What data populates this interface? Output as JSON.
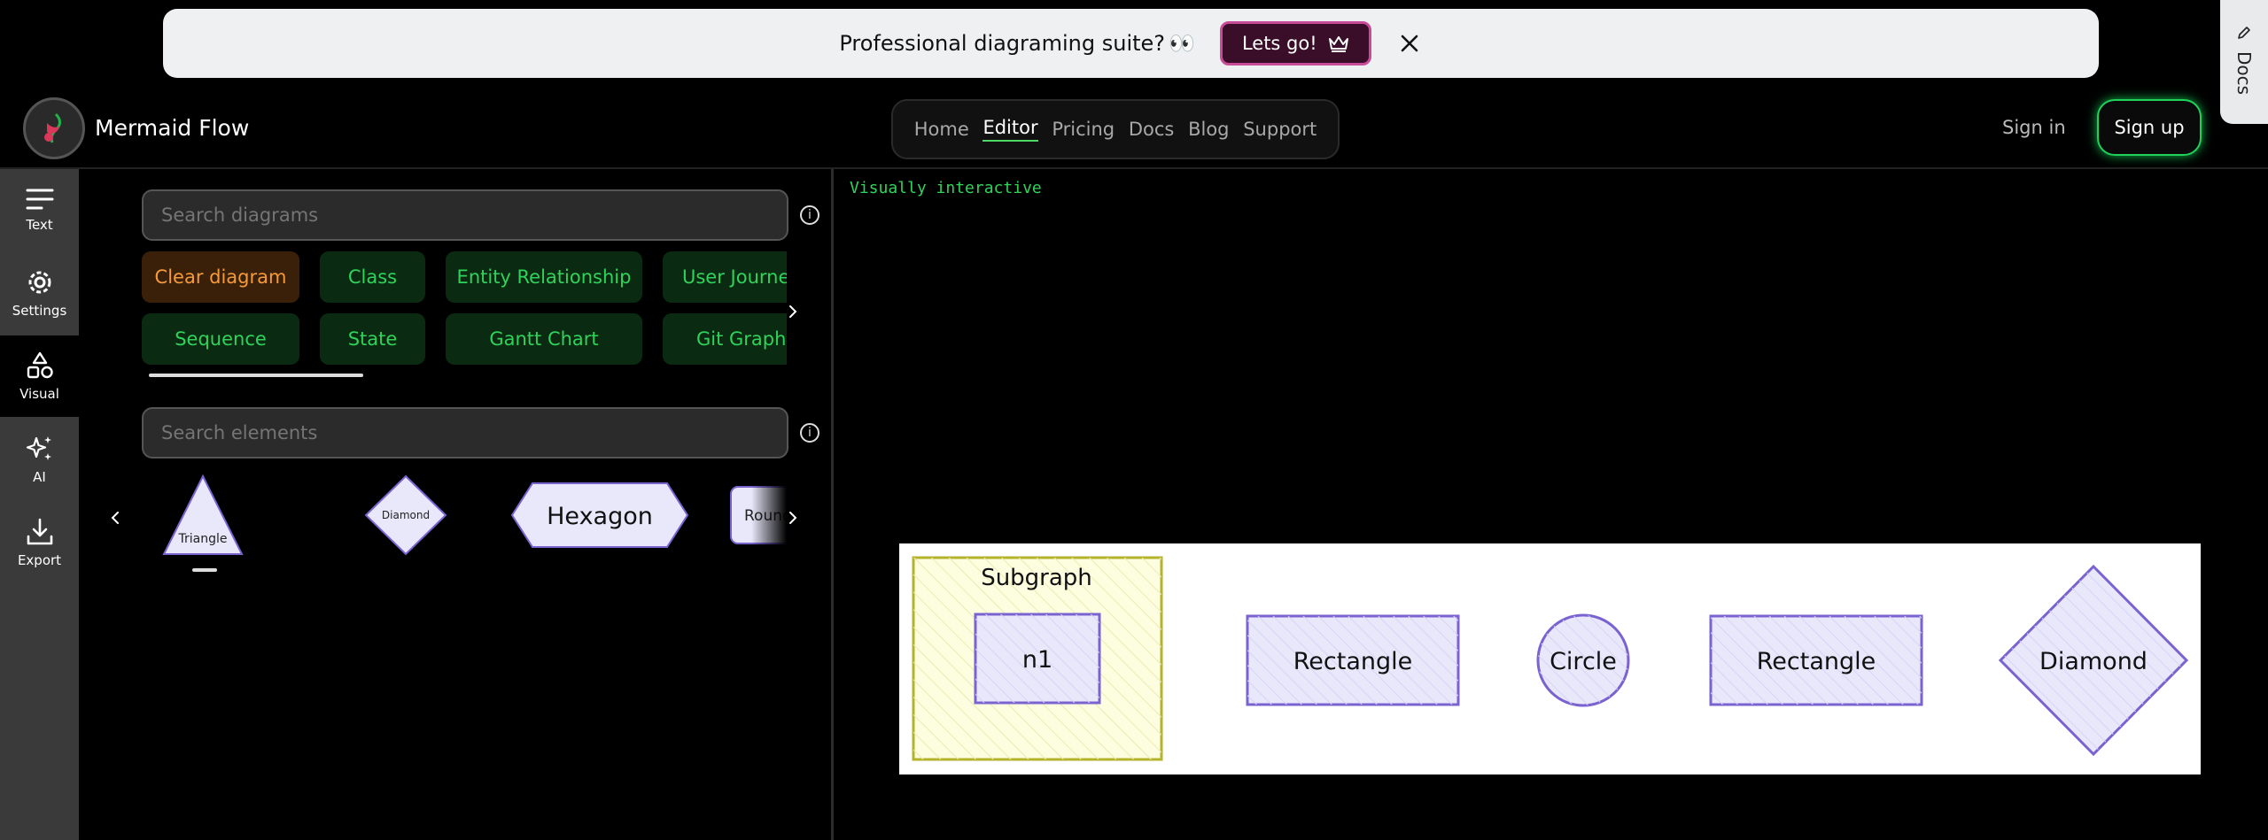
{
  "banner": {
    "text": "Professional diagraming suite?",
    "emoji": "👀",
    "button_label": "Lets go!"
  },
  "docs_tab": {
    "label": "Docs"
  },
  "header": {
    "brand": "Mermaid Flow",
    "nav": [
      {
        "label": "Home",
        "active": false
      },
      {
        "label": "Editor",
        "active": true
      },
      {
        "label": "Pricing",
        "active": false
      },
      {
        "label": "Docs",
        "active": false
      },
      {
        "label": "Blog",
        "active": false
      },
      {
        "label": "Support",
        "active": false
      }
    ],
    "sign_in": "Sign in",
    "sign_up": "Sign up"
  },
  "rail": [
    {
      "label": "Text",
      "icon": "text-lines-icon",
      "active": false
    },
    {
      "label": "Settings",
      "icon": "gear-icon",
      "active": false
    },
    {
      "label": "Visual",
      "icon": "shapes-icon",
      "active": true
    },
    {
      "label": "AI",
      "icon": "sparkles-icon",
      "active": false
    },
    {
      "label": "Export",
      "icon": "download-icon",
      "active": false
    }
  ],
  "diagram_search": {
    "placeholder": "Search diagrams"
  },
  "diagram_chips": [
    {
      "label": "Clear diagram",
      "kind": "clear"
    },
    {
      "label": "Class",
      "kind": "type"
    },
    {
      "label": "Entity Relationship",
      "kind": "type"
    },
    {
      "label": "User Journey",
      "kind": "type"
    },
    {
      "label": "Sequence",
      "kind": "type"
    },
    {
      "label": "State",
      "kind": "type"
    },
    {
      "label": "Gantt Chart",
      "kind": "type"
    },
    {
      "label": "Git Graph",
      "kind": "type"
    }
  ],
  "element_search": {
    "placeholder": "Search elements"
  },
  "elements": [
    {
      "label": "Triangle",
      "shape": "triangle"
    },
    {
      "label": "Diamond",
      "shape": "diamond"
    },
    {
      "label": "Hexagon",
      "shape": "hexagon"
    },
    {
      "label": "Rounded",
      "shape": "rounded"
    }
  ],
  "editor": {
    "code_text": "Visually interactive"
  },
  "diagram": {
    "subgraph_title": "Subgraph",
    "nodes": [
      {
        "label": "n1",
        "shape": "rect"
      },
      {
        "label": "Rectangle",
        "shape": "rect"
      },
      {
        "label": "Circle",
        "shape": "circle"
      },
      {
        "label": "Rectangle",
        "shape": "rect"
      },
      {
        "label": "Diamond",
        "shape": "diamond"
      }
    ]
  },
  "colors": {
    "accent_green": "#2fd35b",
    "clear_orange": "#f59a3a",
    "node_fill": "#e9e8fb",
    "node_stroke": "#7a63d1",
    "subgraph_fill": "#fdfde0",
    "subgraph_stroke": "#b5b22b"
  }
}
